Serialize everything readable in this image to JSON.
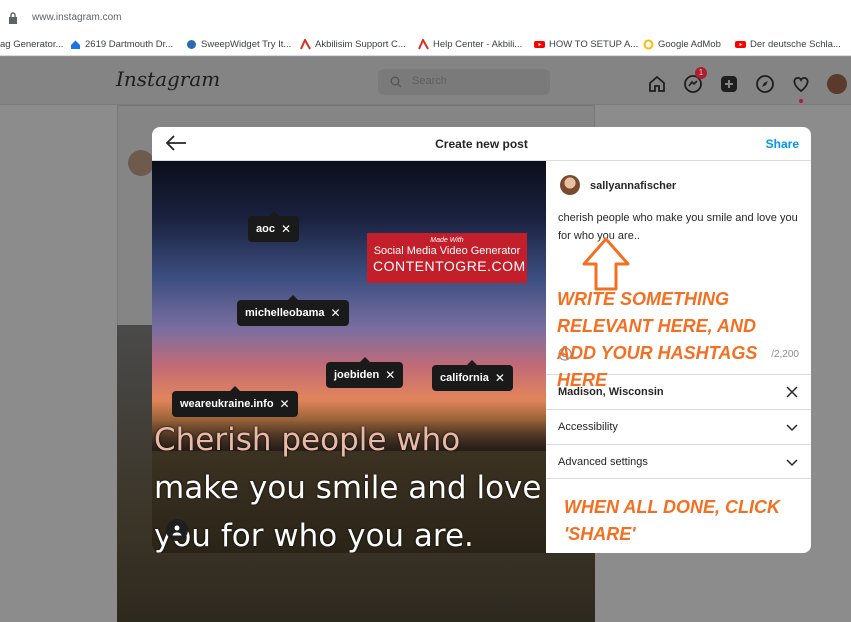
{
  "browser": {
    "url": "www.instagram.com",
    "bookmarks": [
      {
        "label": "ag Generator..."
      },
      {
        "label": "2619 Dartmouth Dr..."
      },
      {
        "label": "SweepWidget Try It..."
      },
      {
        "label": "Akbilisim Support C..."
      },
      {
        "label": "Help Center - Akbili..."
      },
      {
        "label": "HOW TO SETUP A..."
      },
      {
        "label": "Google AdMob"
      },
      {
        "label": "Der deutsche Schla..."
      }
    ]
  },
  "instagram": {
    "logo": "Instagram",
    "search_placeholder": "Search",
    "notification_count": "1"
  },
  "modal": {
    "title": "Create new post",
    "share_label": "Share",
    "media": {
      "watermark": {
        "line1": "Made With",
        "line2": "Social Media Video Generator",
        "line3": "CONTENTOGRE.COM"
      },
      "tags": [
        "aoc",
        "michelleobama",
        "joebiden",
        "california",
        "weareukraine.info"
      ],
      "quote_lines": [
        "Cherish people who",
        "make you smile and love",
        "you for who you are."
      ]
    },
    "panel": {
      "username": "sallyannafischer",
      "caption": "cherish people who make you smile and love you for who you are..",
      "char_count": "/2,200",
      "location": "Madison, Wisconsin",
      "accessibility_label": "Accessibility",
      "advanced_label": "Advanced settings"
    }
  },
  "annotations": {
    "note_write": "WRITE SOMETHING RELEVANT HERE, AND ADD YOUR HASHTAGS HERE",
    "note_share": "WHEN ALL DONE, CLICK 'SHARE'",
    "accent_color": "#f36f21"
  }
}
